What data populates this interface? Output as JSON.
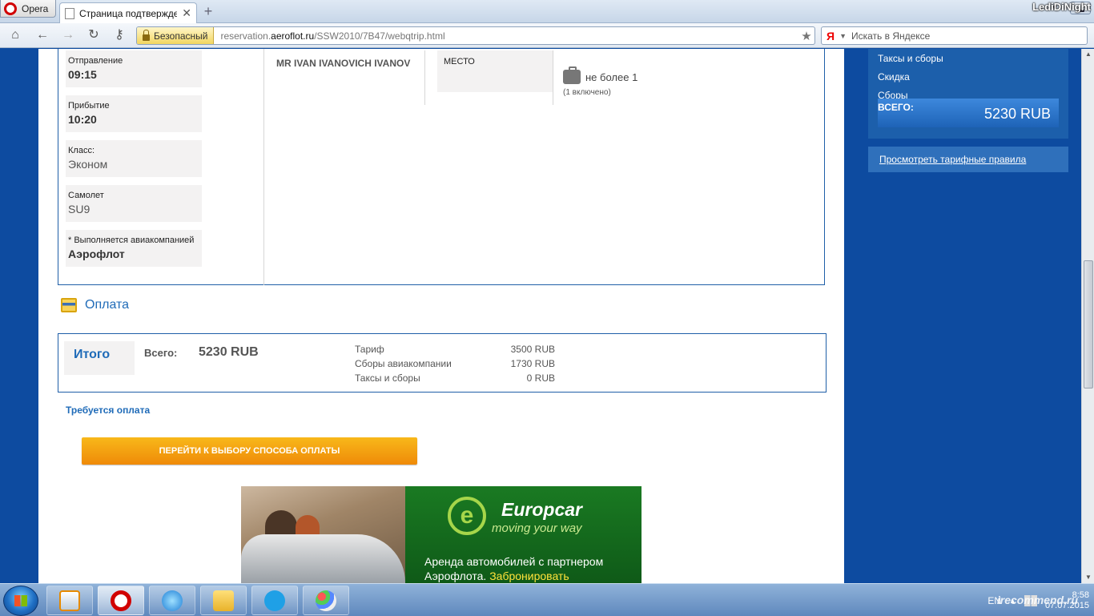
{
  "browser": {
    "menu_label": "Opera",
    "tab_title": "Страница подтвержде...",
    "user_tag": "LediDiNight",
    "secure_label": "Безопасный",
    "url_prefix": "reservation.",
    "url_domain": "aeroflot.ru",
    "url_path": "/SSW2010/7B47/webqtrip.html",
    "search_placeholder": "Искать в Яндексе",
    "search_logo": "Я"
  },
  "flight": {
    "departure": {
      "label": "Отправление",
      "value": "09:15"
    },
    "arrival": {
      "label": "Прибытие",
      "value": "10:20"
    },
    "class": {
      "label": "Класс:",
      "value": "Эконом"
    },
    "aircraft": {
      "label": "Самолет",
      "value": "SU9"
    },
    "operator": {
      "label": "* Выполняется авиакомпанией",
      "value": "Аэрофлот"
    },
    "passenger": "MR IVAN IVANOVICH IVANOV",
    "seat_label": "МЕСТО",
    "baggage": {
      "text": "не более 1",
      "sub": "(1 включено)"
    }
  },
  "payment": {
    "heading": "Оплата",
    "itogo": "Итого",
    "total_label": "Всего:",
    "total_value": "5230 RUB",
    "breakdown": [
      {
        "label": "Тариф",
        "value": "3500 RUB"
      },
      {
        "label": "Сборы авиакомпании",
        "value": "1730 RUB"
      },
      {
        "label": "Таксы и сборы",
        "value": "0 RUB"
      }
    ],
    "required": "Требуется оплата",
    "button": "ПЕРЕЙТИ К ВЫБОРУ СПОСОБА ОПЛАТЫ"
  },
  "sidebar": {
    "rows": [
      "Таксы и сборы",
      "Скидка",
      "Сборы"
    ],
    "total_label": "ВСЕГО:",
    "total_value": "5230 RUB",
    "rules_link": "Просмотреть тарифные правила"
  },
  "banner": {
    "brand": "Europcar",
    "slogan": "moving your way",
    "line1": "Аренда автомобилей с партнером",
    "line2": "Аэрофлота.",
    "cta": "Забронировать"
  },
  "taskbar": {
    "lang": "EN",
    "time": "8:58",
    "date": "07.07.2015",
    "watermark": "irecommend.ru"
  },
  "colors": {
    "page_bg": "#0d4ba0",
    "accent_blue": "#1f6bb8",
    "button_orange": "#f29a0e",
    "banner_green": "#1a7a22"
  }
}
